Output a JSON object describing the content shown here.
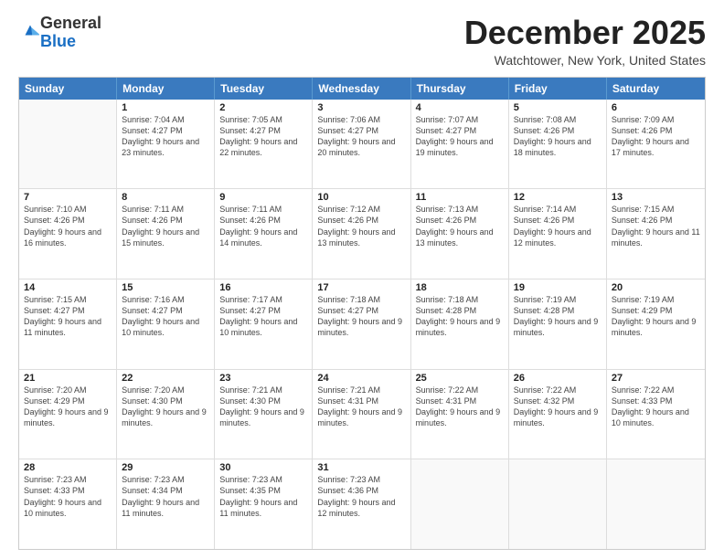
{
  "logo": {
    "general": "General",
    "blue": "Blue"
  },
  "header": {
    "month": "December 2025",
    "location": "Watchtower, New York, United States"
  },
  "days_of_week": [
    "Sunday",
    "Monday",
    "Tuesday",
    "Wednesday",
    "Thursday",
    "Friday",
    "Saturday"
  ],
  "weeks": [
    [
      {
        "day": "",
        "sunrise": "",
        "sunset": "",
        "daylight": "",
        "empty": true
      },
      {
        "day": "1",
        "sunrise": "Sunrise: 7:04 AM",
        "sunset": "Sunset: 4:27 PM",
        "daylight": "Daylight: 9 hours and 23 minutes.",
        "empty": false
      },
      {
        "day": "2",
        "sunrise": "Sunrise: 7:05 AM",
        "sunset": "Sunset: 4:27 PM",
        "daylight": "Daylight: 9 hours and 22 minutes.",
        "empty": false
      },
      {
        "day": "3",
        "sunrise": "Sunrise: 7:06 AM",
        "sunset": "Sunset: 4:27 PM",
        "daylight": "Daylight: 9 hours and 20 minutes.",
        "empty": false
      },
      {
        "day": "4",
        "sunrise": "Sunrise: 7:07 AM",
        "sunset": "Sunset: 4:27 PM",
        "daylight": "Daylight: 9 hours and 19 minutes.",
        "empty": false
      },
      {
        "day": "5",
        "sunrise": "Sunrise: 7:08 AM",
        "sunset": "Sunset: 4:26 PM",
        "daylight": "Daylight: 9 hours and 18 minutes.",
        "empty": false
      },
      {
        "day": "6",
        "sunrise": "Sunrise: 7:09 AM",
        "sunset": "Sunset: 4:26 PM",
        "daylight": "Daylight: 9 hours and 17 minutes.",
        "empty": false
      }
    ],
    [
      {
        "day": "7",
        "sunrise": "Sunrise: 7:10 AM",
        "sunset": "Sunset: 4:26 PM",
        "daylight": "Daylight: 9 hours and 16 minutes.",
        "empty": false
      },
      {
        "day": "8",
        "sunrise": "Sunrise: 7:11 AM",
        "sunset": "Sunset: 4:26 PM",
        "daylight": "Daylight: 9 hours and 15 minutes.",
        "empty": false
      },
      {
        "day": "9",
        "sunrise": "Sunrise: 7:11 AM",
        "sunset": "Sunset: 4:26 PM",
        "daylight": "Daylight: 9 hours and 14 minutes.",
        "empty": false
      },
      {
        "day": "10",
        "sunrise": "Sunrise: 7:12 AM",
        "sunset": "Sunset: 4:26 PM",
        "daylight": "Daylight: 9 hours and 13 minutes.",
        "empty": false
      },
      {
        "day": "11",
        "sunrise": "Sunrise: 7:13 AM",
        "sunset": "Sunset: 4:26 PM",
        "daylight": "Daylight: 9 hours and 13 minutes.",
        "empty": false
      },
      {
        "day": "12",
        "sunrise": "Sunrise: 7:14 AM",
        "sunset": "Sunset: 4:26 PM",
        "daylight": "Daylight: 9 hours and 12 minutes.",
        "empty": false
      },
      {
        "day": "13",
        "sunrise": "Sunrise: 7:15 AM",
        "sunset": "Sunset: 4:26 PM",
        "daylight": "Daylight: 9 hours and 11 minutes.",
        "empty": false
      }
    ],
    [
      {
        "day": "14",
        "sunrise": "Sunrise: 7:15 AM",
        "sunset": "Sunset: 4:27 PM",
        "daylight": "Daylight: 9 hours and 11 minutes.",
        "empty": false
      },
      {
        "day": "15",
        "sunrise": "Sunrise: 7:16 AM",
        "sunset": "Sunset: 4:27 PM",
        "daylight": "Daylight: 9 hours and 10 minutes.",
        "empty": false
      },
      {
        "day": "16",
        "sunrise": "Sunrise: 7:17 AM",
        "sunset": "Sunset: 4:27 PM",
        "daylight": "Daylight: 9 hours and 10 minutes.",
        "empty": false
      },
      {
        "day": "17",
        "sunrise": "Sunrise: 7:18 AM",
        "sunset": "Sunset: 4:27 PM",
        "daylight": "Daylight: 9 hours and 9 minutes.",
        "empty": false
      },
      {
        "day": "18",
        "sunrise": "Sunrise: 7:18 AM",
        "sunset": "Sunset: 4:28 PM",
        "daylight": "Daylight: 9 hours and 9 minutes.",
        "empty": false
      },
      {
        "day": "19",
        "sunrise": "Sunrise: 7:19 AM",
        "sunset": "Sunset: 4:28 PM",
        "daylight": "Daylight: 9 hours and 9 minutes.",
        "empty": false
      },
      {
        "day": "20",
        "sunrise": "Sunrise: 7:19 AM",
        "sunset": "Sunset: 4:29 PM",
        "daylight": "Daylight: 9 hours and 9 minutes.",
        "empty": false
      }
    ],
    [
      {
        "day": "21",
        "sunrise": "Sunrise: 7:20 AM",
        "sunset": "Sunset: 4:29 PM",
        "daylight": "Daylight: 9 hours and 9 minutes.",
        "empty": false
      },
      {
        "day": "22",
        "sunrise": "Sunrise: 7:20 AM",
        "sunset": "Sunset: 4:30 PM",
        "daylight": "Daylight: 9 hours and 9 minutes.",
        "empty": false
      },
      {
        "day": "23",
        "sunrise": "Sunrise: 7:21 AM",
        "sunset": "Sunset: 4:30 PM",
        "daylight": "Daylight: 9 hours and 9 minutes.",
        "empty": false
      },
      {
        "day": "24",
        "sunrise": "Sunrise: 7:21 AM",
        "sunset": "Sunset: 4:31 PM",
        "daylight": "Daylight: 9 hours and 9 minutes.",
        "empty": false
      },
      {
        "day": "25",
        "sunrise": "Sunrise: 7:22 AM",
        "sunset": "Sunset: 4:31 PM",
        "daylight": "Daylight: 9 hours and 9 minutes.",
        "empty": false
      },
      {
        "day": "26",
        "sunrise": "Sunrise: 7:22 AM",
        "sunset": "Sunset: 4:32 PM",
        "daylight": "Daylight: 9 hours and 9 minutes.",
        "empty": false
      },
      {
        "day": "27",
        "sunrise": "Sunrise: 7:22 AM",
        "sunset": "Sunset: 4:33 PM",
        "daylight": "Daylight: 9 hours and 10 minutes.",
        "empty": false
      }
    ],
    [
      {
        "day": "28",
        "sunrise": "Sunrise: 7:23 AM",
        "sunset": "Sunset: 4:33 PM",
        "daylight": "Daylight: 9 hours and 10 minutes.",
        "empty": false
      },
      {
        "day": "29",
        "sunrise": "Sunrise: 7:23 AM",
        "sunset": "Sunset: 4:34 PM",
        "daylight": "Daylight: 9 hours and 11 minutes.",
        "empty": false
      },
      {
        "day": "30",
        "sunrise": "Sunrise: 7:23 AM",
        "sunset": "Sunset: 4:35 PM",
        "daylight": "Daylight: 9 hours and 11 minutes.",
        "empty": false
      },
      {
        "day": "31",
        "sunrise": "Sunrise: 7:23 AM",
        "sunset": "Sunset: 4:36 PM",
        "daylight": "Daylight: 9 hours and 12 minutes.",
        "empty": false
      },
      {
        "day": "",
        "sunrise": "",
        "sunset": "",
        "daylight": "",
        "empty": true
      },
      {
        "day": "",
        "sunrise": "",
        "sunset": "",
        "daylight": "",
        "empty": true
      },
      {
        "day": "",
        "sunrise": "",
        "sunset": "",
        "daylight": "",
        "empty": true
      }
    ]
  ]
}
